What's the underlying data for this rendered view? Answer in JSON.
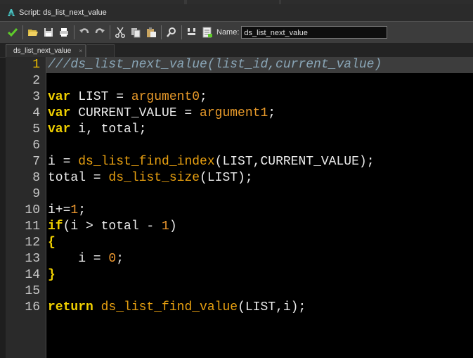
{
  "window": {
    "title": "Script: ds_list_next_value"
  },
  "toolbar": {
    "buttons": [
      {
        "name": "ok-button",
        "icon": "checkmark-icon",
        "color": "#5ecb2a"
      },
      {
        "name": "open-button",
        "icon": "folder-open-icon",
        "color": "#e0c040"
      },
      {
        "name": "save-button",
        "icon": "floppy-icon",
        "color": "#d8d8d8"
      },
      {
        "name": "print-button",
        "icon": "printer-icon",
        "color": "#d8d8d8"
      },
      {
        "name": "undo-button",
        "icon": "undo-icon",
        "color": "#bbbbbb"
      },
      {
        "name": "redo-button",
        "icon": "redo-icon",
        "color": "#bbbbbb"
      },
      {
        "name": "cut-button",
        "icon": "scissors-icon",
        "color": "#cccccc"
      },
      {
        "name": "copy-button",
        "icon": "copy-icon",
        "color": "#cccccc"
      },
      {
        "name": "paste-button",
        "icon": "clipboard-icon",
        "color": "#cccccc"
      },
      {
        "name": "find-button",
        "icon": "magnifier-icon",
        "color": "#cccccc"
      },
      {
        "name": "goto-line-button",
        "icon": "goto-icon",
        "color": "#cccccc"
      },
      {
        "name": "script-settings-button",
        "icon": "document-icon",
        "color": "#cccccc"
      }
    ],
    "name_label": "Name:",
    "name_value": "ds_list_next_value"
  },
  "tabs": [
    {
      "label": "ds_list_next_value",
      "close": "×"
    }
  ],
  "editor": {
    "active_line": 1,
    "lines": [
      {
        "n": "1",
        "tokens": [
          [
            "cm",
            "///ds_list_next_value(list_id,current_value)"
          ]
        ]
      },
      {
        "n": "2",
        "tokens": []
      },
      {
        "n": "3",
        "tokens": [
          [
            "kw",
            "var"
          ],
          [
            "pl",
            " LIST = "
          ],
          [
            "ar",
            "argument0"
          ],
          [
            "pl",
            ";"
          ]
        ]
      },
      {
        "n": "4",
        "tokens": [
          [
            "kw",
            "var"
          ],
          [
            "pl",
            " CURRENT_VALUE = "
          ],
          [
            "ar",
            "argument1"
          ],
          [
            "pl",
            ";"
          ]
        ]
      },
      {
        "n": "5",
        "tokens": [
          [
            "kw",
            "var"
          ],
          [
            "pl",
            " i, total;"
          ]
        ]
      },
      {
        "n": "6",
        "tokens": []
      },
      {
        "n": "7",
        "tokens": [
          [
            "pl",
            "i = "
          ],
          [
            "fn",
            "ds_list_find_index"
          ],
          [
            "pl",
            "(LIST,CURRENT_VALUE);"
          ]
        ]
      },
      {
        "n": "8",
        "tokens": [
          [
            "pl",
            "total = "
          ],
          [
            "fn",
            "ds_list_size"
          ],
          [
            "pl",
            "(LIST);"
          ]
        ]
      },
      {
        "n": "9",
        "tokens": []
      },
      {
        "n": "10",
        "tokens": [
          [
            "pl",
            "i+="
          ],
          [
            "nm",
            "1"
          ],
          [
            "pl",
            ";"
          ]
        ]
      },
      {
        "n": "11",
        "tokens": [
          [
            "kw",
            "if"
          ],
          [
            "pl",
            "(i > total - "
          ],
          [
            "nm",
            "1"
          ],
          [
            "pl",
            ")"
          ]
        ]
      },
      {
        "n": "12",
        "tokens": [
          [
            "br",
            "{"
          ]
        ]
      },
      {
        "n": "13",
        "tokens": [
          [
            "pl",
            "    i = "
          ],
          [
            "nm",
            "0"
          ],
          [
            "pl",
            ";"
          ]
        ]
      },
      {
        "n": "14",
        "tokens": [
          [
            "br",
            "}"
          ]
        ]
      },
      {
        "n": "15",
        "tokens": []
      },
      {
        "n": "16",
        "tokens": [
          [
            "kw",
            "return"
          ],
          [
            "pl",
            " "
          ],
          [
            "fn",
            "ds_list_find_value"
          ],
          [
            "pl",
            "(LIST,i);"
          ]
        ]
      }
    ]
  }
}
